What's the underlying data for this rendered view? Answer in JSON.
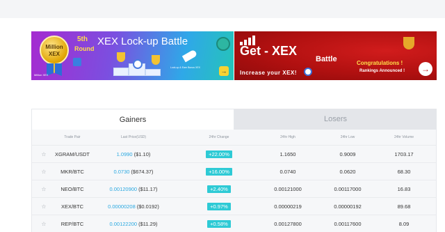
{
  "banners": {
    "lockup": {
      "medal_text": "Million XEX",
      "round_number": "5th",
      "round_word": "Round",
      "title": "XEX Lock-up Battle",
      "small_text": "Lock-up & Earn Bonus XEX",
      "footer": "Million XEX"
    },
    "battle": {
      "title": "Get - XEX",
      "battle_word": "Battle",
      "subtitle": "Increase your XEX!",
      "congrats": "Congratulations !",
      "rankings": "Rankings Announced !"
    }
  },
  "tabs": {
    "gainers": "Gainers",
    "losers": "Losers",
    "active": "gainers"
  },
  "table": {
    "headers": {
      "pair": "Trade Pair",
      "price": "Last Price(USD)",
      "change": "24hr Change",
      "high": "24hr High",
      "low": "24hr Low",
      "volume": "24hr Volume"
    },
    "rows": [
      {
        "pair": "XGRAM/USDT",
        "price": "1.0990",
        "price_usd": "($1.10)",
        "change": "+22.00%",
        "high": "1.1650",
        "low": "0.9009",
        "volume": "1703.17"
      },
      {
        "pair": "MKR/BTC",
        "price": "0.0730",
        "price_usd": "($674.37)",
        "change": "+16.00%",
        "high": "0.0740",
        "low": "0.0620",
        "volume": "68.30"
      },
      {
        "pair": "NEO/BTC",
        "price": "0.00120900",
        "price_usd": "($11.17)",
        "change": "+2.40%",
        "high": "0.00121000",
        "low": "0.00117000",
        "volume": "16.83"
      },
      {
        "pair": "XEX/BTC",
        "price": "0.00000208",
        "price_usd": "($0.0192)",
        "change": "+0.97%",
        "high": "0.00000219",
        "low": "0.00000192",
        "volume": "89.68"
      },
      {
        "pair": "REP/BTC",
        "price": "0.00122200",
        "price_usd": "($11.29)",
        "change": "+0.58%",
        "high": "0.00127800",
        "low": "0.00117600",
        "volume": "8.09"
      }
    ]
  },
  "colors": {
    "accent": "#2aa8e0",
    "change_badge": "#2ecad5",
    "battle_red": "#b01010"
  },
  "icons": {
    "favorite": "star-outline-icon"
  }
}
